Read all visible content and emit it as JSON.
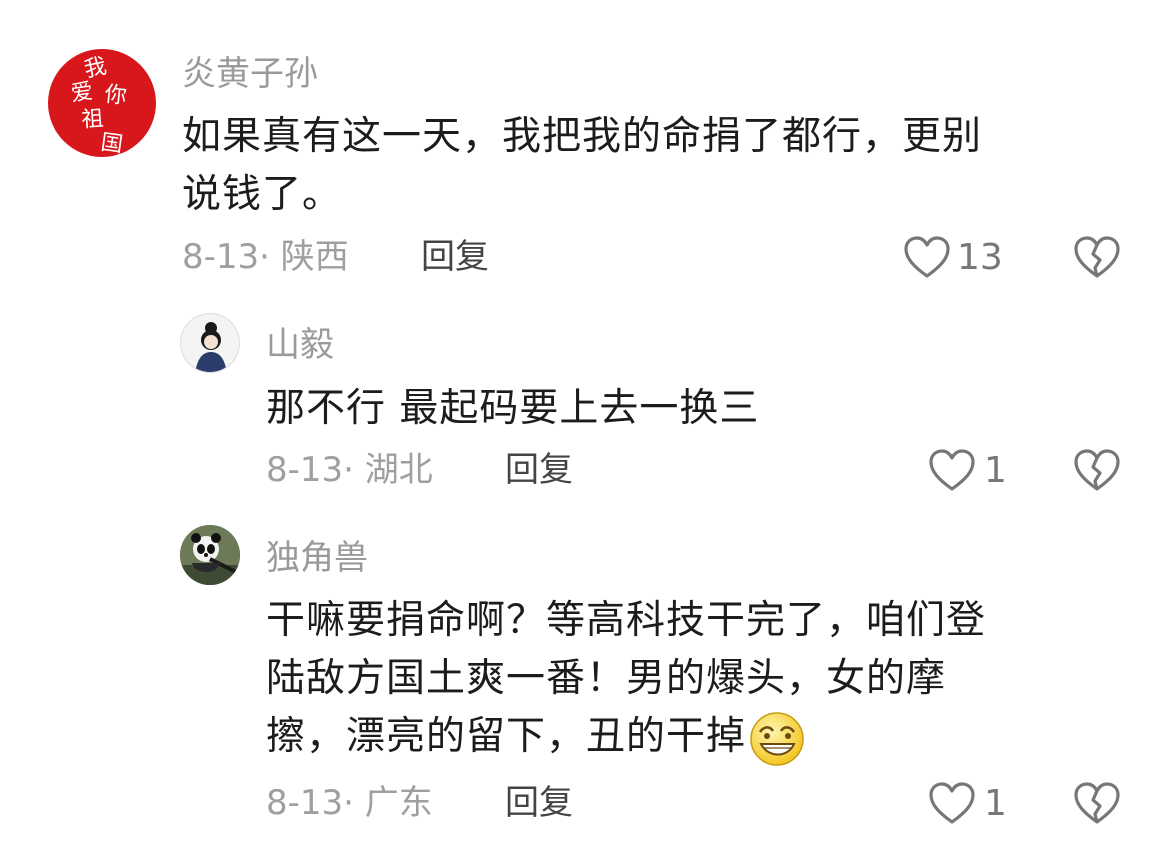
{
  "comments": [
    {
      "username": "炎黄子孙",
      "avatar_text": "我爱你祖国",
      "text": "如果真有这一天，我把我的命捐了都行，更别说钱了。",
      "text_lines": [
        "如果真有这一天，我把我的命捐了都行，更别",
        "说钱了。"
      ],
      "date_location": "8-13· 陕西",
      "reply_label": "回复",
      "likes": "13"
    },
    {
      "username": "山毅",
      "text": "那不行 最起码要上去一换三",
      "date_location": "8-13· 湖北",
      "reply_label": "回复",
      "likes": "1"
    },
    {
      "username": "独角兽",
      "text_lines": [
        "干嘛要捐命啊？等高科技干完了，咱们登",
        "陆敌方国土爽一番！男的爆头，女的摩",
        "擦，漂亮的留下，丑的干掉"
      ],
      "date_location": "8-13· 广东",
      "reply_label": "回复",
      "likes": "1"
    }
  ],
  "colors": {
    "avatar_red": "#d8171c",
    "text": "#1c1c1c",
    "muted": "#9a9a9a",
    "icon": "#777777"
  },
  "icons": [
    "heart-outline-icon",
    "broken-heart-icon",
    "grinning-emoji-icon"
  ]
}
